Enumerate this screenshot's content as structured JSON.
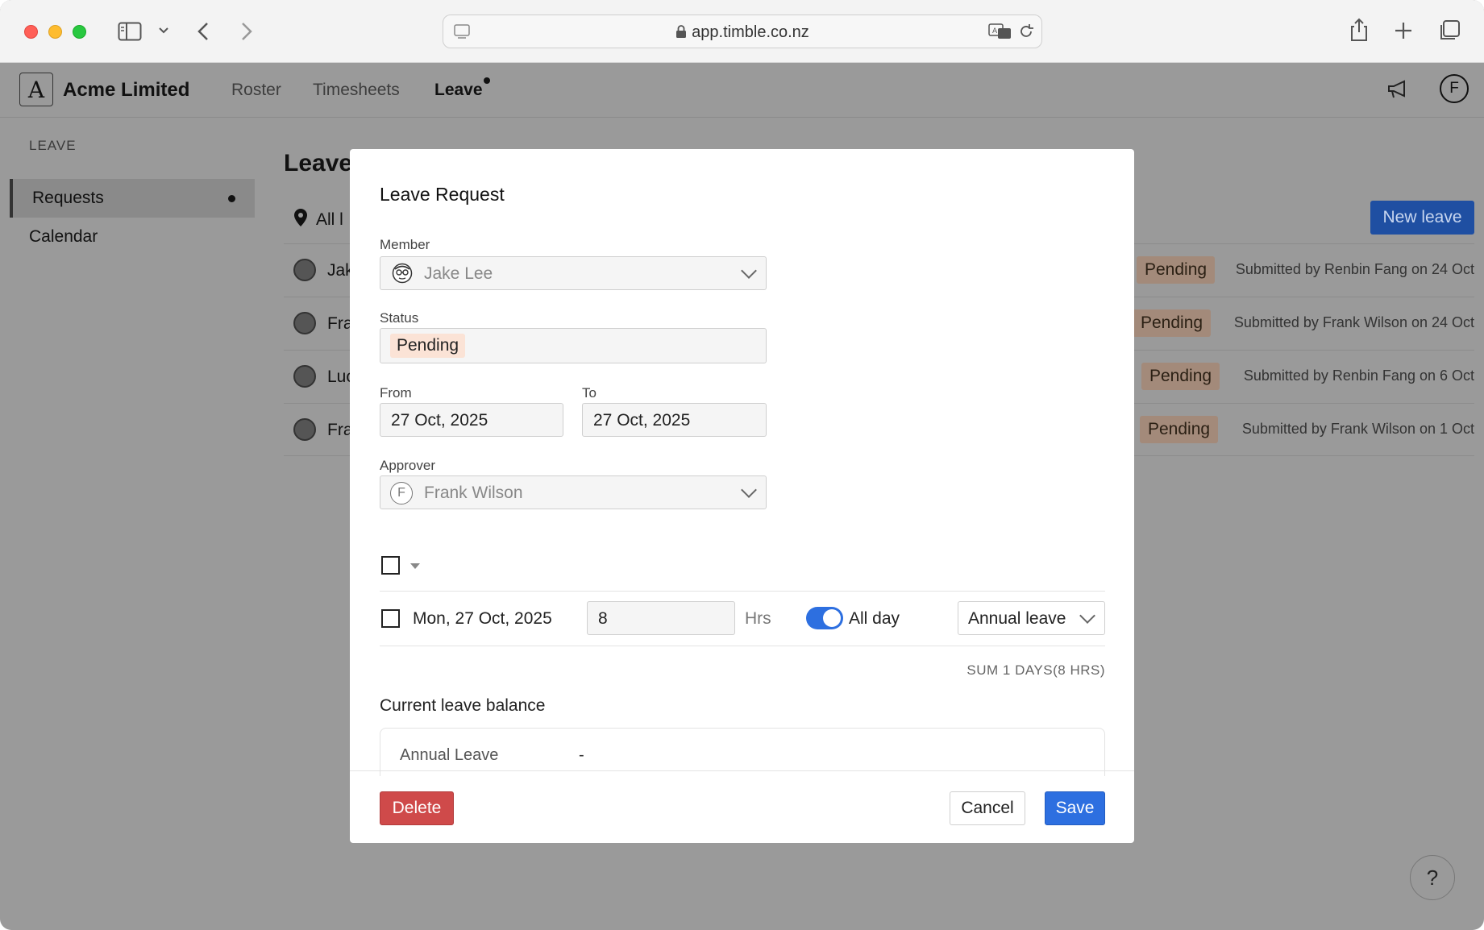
{
  "browser": {
    "url": "app.timble.co.nz"
  },
  "header": {
    "logo_letter": "A",
    "company": "Acme Limited",
    "nav": [
      "Roster",
      "Timesheets",
      "Leave"
    ],
    "user_initial": "F"
  },
  "sidebar": {
    "title": "LEAVE",
    "items": [
      {
        "label": "Requests",
        "active": true
      },
      {
        "label": "Calendar",
        "active": false
      }
    ]
  },
  "main": {
    "title": "Leave",
    "filter_label": "All l",
    "new_leave_label": "New leave",
    "rows": [
      {
        "name": "Jak",
        "status": "Pending",
        "submitted": "Submitted by Renbin Fang on 24 Oct"
      },
      {
        "name": "Fra",
        "status": "Pending",
        "submitted": "Submitted by Frank Wilson on 24 Oct"
      },
      {
        "name": "Luc",
        "status": "Pending",
        "submitted": "Submitted by Renbin Fang on 6 Oct"
      },
      {
        "name": "Fra",
        "status": "Pending",
        "submitted": "Submitted by Frank Wilson on 1 Oct"
      }
    ],
    "help_label": "?"
  },
  "modal": {
    "title": "Leave Request",
    "member_label": "Member",
    "member_value": "Jake Lee",
    "status_label": "Status",
    "status_value": "Pending",
    "from_label": "From",
    "from_value": "27 Oct, 2025",
    "to_label": "To",
    "to_value": "27 Oct, 2025",
    "approver_label": "Approver",
    "approver_initial": "F",
    "approver_value": "Frank Wilson",
    "day_row": {
      "date": "Mon, 27 Oct, 2025",
      "hours": "8",
      "hours_unit": "Hrs",
      "all_day_label": "All day",
      "all_day_on": true,
      "leave_type": "Annual leave"
    },
    "sum_text": "SUM 1 DAYS(8 HRS)",
    "balance_title": "Current leave balance",
    "balance_rows": [
      {
        "type": "Annual Leave",
        "value": "-"
      }
    ],
    "delete_label": "Delete",
    "cancel_label": "Cancel",
    "save_label": "Save"
  },
  "colors": {
    "primary": "#2d6fe0",
    "danger": "#cf4a4a",
    "pending_chip": "#fbe3d6",
    "overlay": "#9a9a9a"
  }
}
